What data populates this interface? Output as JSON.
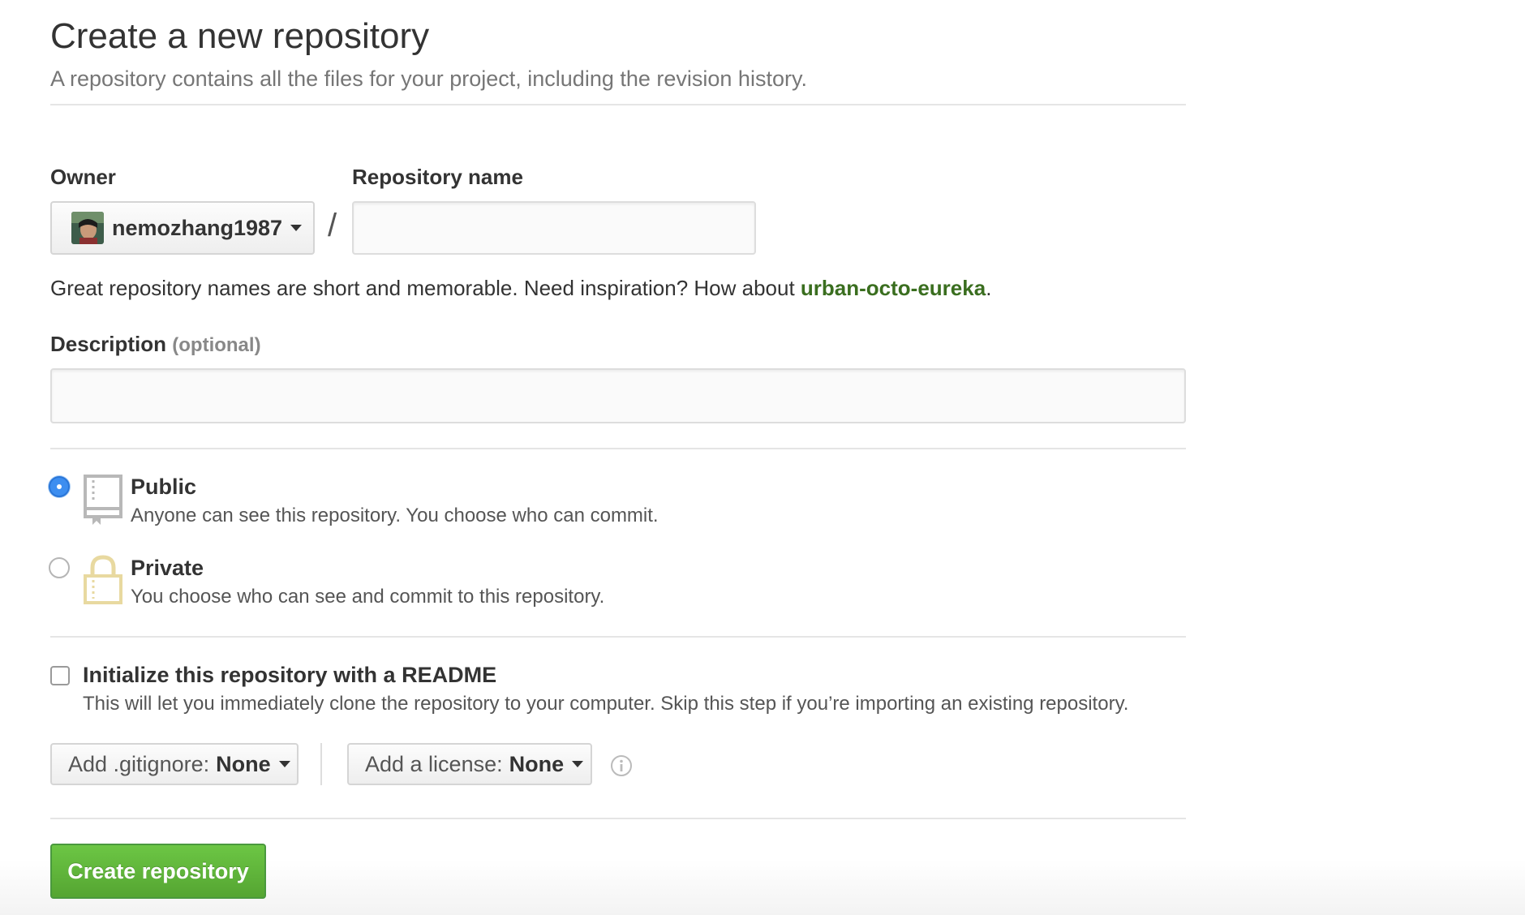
{
  "header": {
    "title": "Create a new repository",
    "subtitle": "A repository contains all the files for your project, including the revision history."
  },
  "owner": {
    "label": "Owner",
    "selected": "nemozhang1987"
  },
  "separator": "/",
  "repo_name": {
    "label": "Repository name",
    "value": "",
    "placeholder": ""
  },
  "name_hint": {
    "text": "Great repository names are short and memorable. Need inspiration? How about ",
    "suggestion": "urban-octo-eureka",
    "end": "."
  },
  "description": {
    "label": "Description",
    "optional": "(optional)",
    "value": "",
    "placeholder": ""
  },
  "visibility": {
    "selected": "public",
    "public": {
      "title": "Public",
      "desc": "Anyone can see this repository. You choose who can commit.",
      "icon": "repo-book-icon"
    },
    "private": {
      "title": "Private",
      "desc": "You choose who can see and commit to this repository.",
      "icon": "lock-icon"
    }
  },
  "readme": {
    "checked": false,
    "label": "Initialize this repository with a README",
    "desc": "This will let you immediately clone the repository to your computer. Skip this step if you’re importing an existing repository."
  },
  "gitignore": {
    "prefix": "Add .gitignore:",
    "value": "None"
  },
  "license": {
    "prefix": "Add a license:",
    "value": "None"
  },
  "submit": {
    "label": "Create repository"
  },
  "colors": {
    "primary_green": "#55a532",
    "suggestion_green": "#3a6e1f",
    "radio_blue": "#3d8ef0",
    "lock_yellow": "#e8d9a0"
  }
}
